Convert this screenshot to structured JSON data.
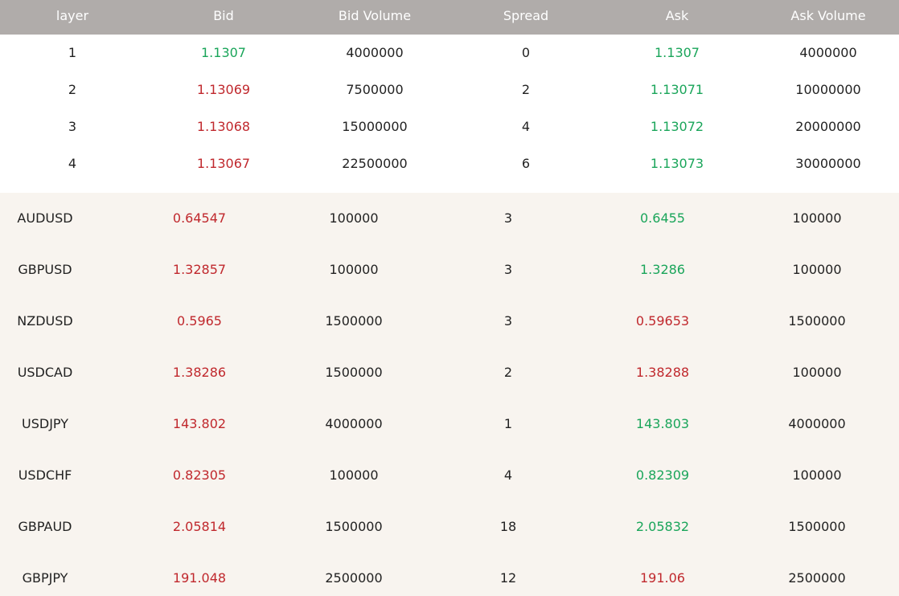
{
  "colors": {
    "header_bg": "#b0acaa",
    "header_text": "#ffffff",
    "quotes_bg": "#f8f4ef",
    "up": "#1aa55a",
    "down": "#c0282d"
  },
  "depth": {
    "headers": {
      "layer": "layer",
      "bid": "Bid",
      "bid_volume": "Bid Volume",
      "spread": "Spread",
      "ask": "Ask",
      "ask_volume": "Ask Volume"
    },
    "rows": [
      {
        "layer": "1",
        "bid": "1.1307",
        "bid_dir": "up",
        "bid_volume": "4000000",
        "spread": "0",
        "ask": "1.1307",
        "ask_dir": "up",
        "ask_volume": "4000000"
      },
      {
        "layer": "2",
        "bid": "1.13069",
        "bid_dir": "down",
        "bid_volume": "7500000",
        "spread": "2",
        "ask": "1.13071",
        "ask_dir": "up",
        "ask_volume": "10000000"
      },
      {
        "layer": "3",
        "bid": "1.13068",
        "bid_dir": "down",
        "bid_volume": "15000000",
        "spread": "4",
        "ask": "1.13072",
        "ask_dir": "up",
        "ask_volume": "20000000"
      },
      {
        "layer": "4",
        "bid": "1.13067",
        "bid_dir": "down",
        "bid_volume": "22500000",
        "spread": "6",
        "ask": "1.13073",
        "ask_dir": "up",
        "ask_volume": "30000000"
      }
    ]
  },
  "quotes": {
    "rows": [
      {
        "symbol": "AUDUSD",
        "bid": "0.64547",
        "bid_dir": "down",
        "bid_volume": "100000",
        "spread": "3",
        "ask": "0.6455",
        "ask_dir": "up",
        "ask_volume": "100000"
      },
      {
        "symbol": "GBPUSD",
        "bid": "1.32857",
        "bid_dir": "down",
        "bid_volume": "100000",
        "spread": "3",
        "ask": "1.3286",
        "ask_dir": "up",
        "ask_volume": "100000"
      },
      {
        "symbol": "NZDUSD",
        "bid": "0.5965",
        "bid_dir": "down",
        "bid_volume": "1500000",
        "spread": "3",
        "ask": "0.59653",
        "ask_dir": "down",
        "ask_volume": "1500000"
      },
      {
        "symbol": "USDCAD",
        "bid": "1.38286",
        "bid_dir": "down",
        "bid_volume": "1500000",
        "spread": "2",
        "ask": "1.38288",
        "ask_dir": "down",
        "ask_volume": "100000"
      },
      {
        "symbol": "USDJPY",
        "bid": "143.802",
        "bid_dir": "down",
        "bid_volume": "4000000",
        "spread": "1",
        "ask": "143.803",
        "ask_dir": "up",
        "ask_volume": "4000000"
      },
      {
        "symbol": "USDCHF",
        "bid": "0.82305",
        "bid_dir": "down",
        "bid_volume": "100000",
        "spread": "4",
        "ask": "0.82309",
        "ask_dir": "up",
        "ask_volume": "100000"
      },
      {
        "symbol": "GBPAUD",
        "bid": "2.05814",
        "bid_dir": "down",
        "bid_volume": "1500000",
        "spread": "18",
        "ask": "2.05832",
        "ask_dir": "up",
        "ask_volume": "1500000"
      },
      {
        "symbol": "GBPJPY",
        "bid": "191.048",
        "bid_dir": "down",
        "bid_volume": "2500000",
        "spread": "12",
        "ask": "191.06",
        "ask_dir": "down",
        "ask_volume": "2500000"
      }
    ]
  }
}
